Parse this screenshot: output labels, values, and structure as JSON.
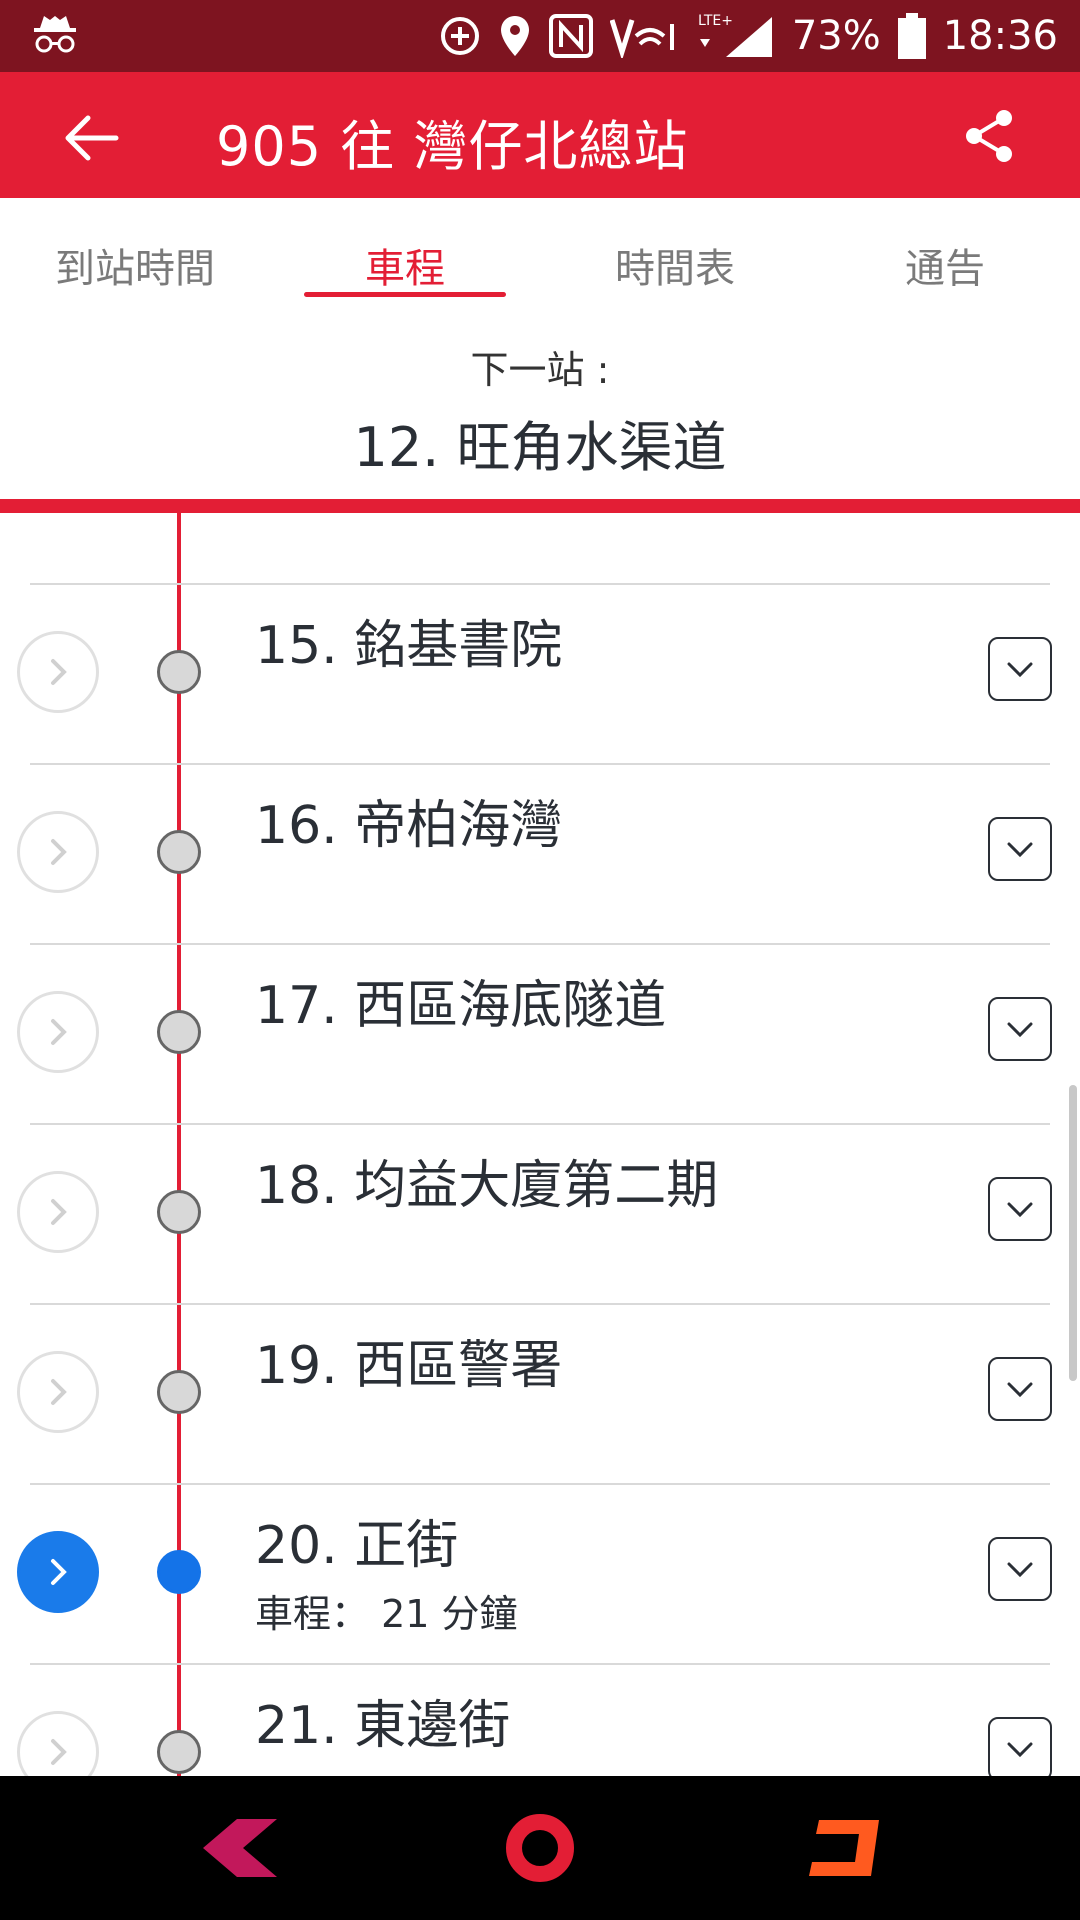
{
  "status_bar": {
    "battery_percent": "73%",
    "time": "18:36",
    "icons": [
      "incognito-icon",
      "data-saver-icon",
      "location-icon",
      "nfc-icon",
      "volte-icon",
      "wifi-calling-icon",
      "lte-signal-icon",
      "battery-icon"
    ]
  },
  "app_bar": {
    "title": "905 往 灣仔北總站",
    "back_icon": "back-arrow-icon",
    "share_icon": "share-icon",
    "bar_color": "#e31e35"
  },
  "tabs": [
    {
      "label": "到站時間",
      "active": false
    },
    {
      "label": "車程",
      "active": true
    },
    {
      "label": "時間表",
      "active": false
    },
    {
      "label": "通告",
      "active": false
    }
  ],
  "next_stop": {
    "label": "下一站 :",
    "name": "12. 旺角水渠道"
  },
  "stops": [
    {
      "name": "15. 銘基書院",
      "sub": "",
      "active": false
    },
    {
      "name": "16. 帝柏海灣",
      "sub": "",
      "active": false
    },
    {
      "name": "17. 西區海底隧道",
      "sub": "",
      "active": false
    },
    {
      "name": "18. 均益大廈第二期",
      "sub": "",
      "active": false
    },
    {
      "name": "19. 西區警署",
      "sub": "",
      "active": false
    },
    {
      "name": "20. 正街",
      "sub": "車程： 21 分鐘",
      "active": true
    },
    {
      "name": "21. 東邊街",
      "sub": "",
      "active": false
    }
  ],
  "colors": {
    "accent": "#e31e35",
    "status_bar": "#7e1420",
    "active_stop": "#1a7bea",
    "text": "#2a2f36"
  },
  "nav_bar": {
    "icons": [
      "back-nav-icon",
      "home-nav-icon",
      "recents-nav-icon"
    ]
  }
}
